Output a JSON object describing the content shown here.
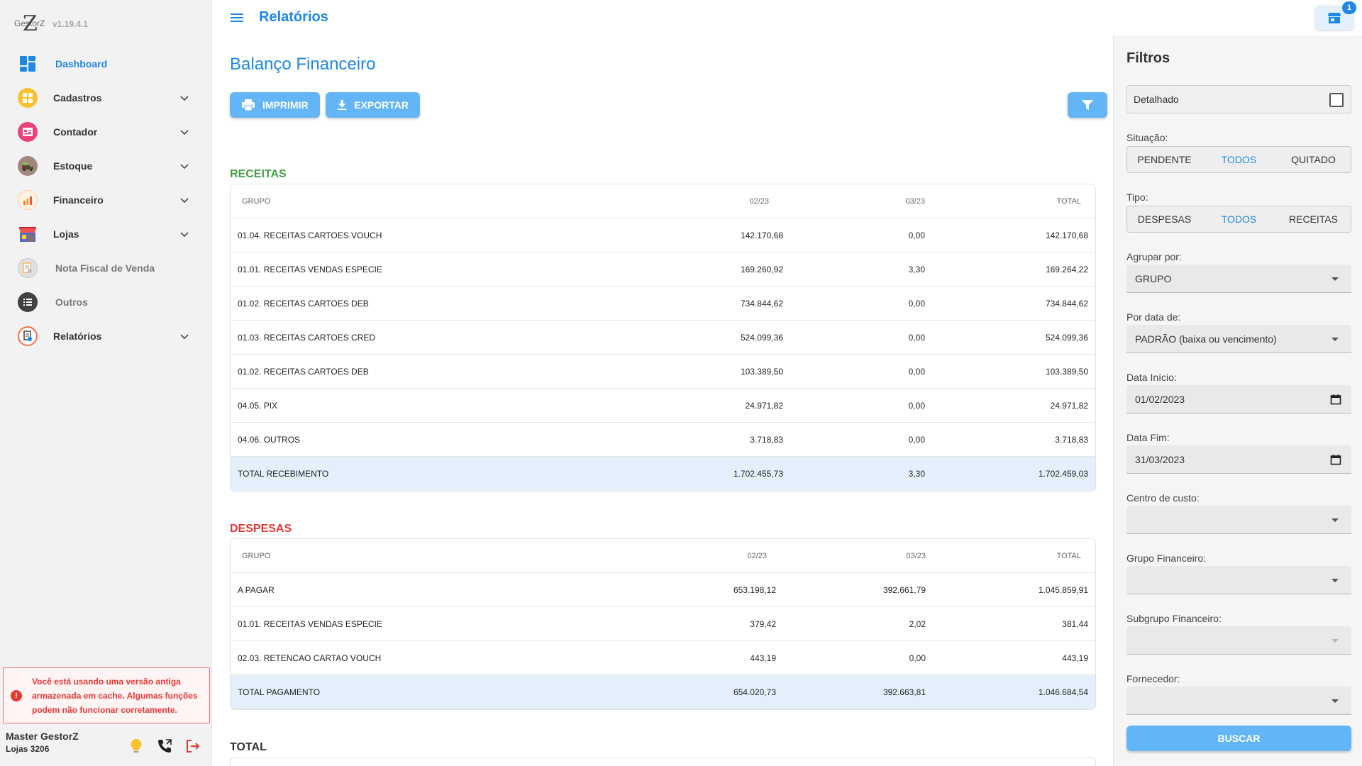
{
  "app": {
    "brand_name": "GestorZ",
    "version": "v1.19.4.1"
  },
  "sidebar": {
    "items": [
      {
        "label": "Dashboard",
        "icon": "dashboard-icon",
        "color": "#1e88e5"
      },
      {
        "label": "Cadastros",
        "icon": "cadastros-icon",
        "color": "#fbc02d"
      },
      {
        "label": "Contador",
        "icon": "contador-icon",
        "color": "#ec407a"
      },
      {
        "label": "Estoque",
        "icon": "estoque-icon",
        "color": "#8d6e63"
      },
      {
        "label": "Financeiro",
        "icon": "financeiro-icon",
        "color": "#ff7043"
      },
      {
        "label": "Lojas",
        "icon": "lojas-icon",
        "color": "#5c6bc0"
      },
      {
        "label": "Nota Fiscal de Venda",
        "icon": "nota-fiscal-icon",
        "color": "#bdbdbd"
      },
      {
        "label": "Outros",
        "icon": "outros-icon",
        "color": "#424242"
      },
      {
        "label": "Relatórios",
        "icon": "relatorios-icon",
        "color": "#ff7043"
      }
    ],
    "cache_alert": "Você está usando uma versão antiga armazenada em cache. Algumas funções podem não funcionar corretamente.",
    "user": {
      "name": "Master GestorZ",
      "store": "Lojas 3206"
    }
  },
  "header": {
    "title": "Relatórios",
    "store_badge": "1"
  },
  "main": {
    "title": "Balanço Financeiro",
    "print_label": "IMPRIMIR",
    "export_label": "EXPORTAR",
    "receitas": {
      "title": "RECEITAS",
      "headers": [
        "GRUPO",
        "02/23",
        "03/23",
        "TOTAL"
      ],
      "rows": [
        [
          "01.04. RECEITAS CARTOES VOUCH",
          "142.170,68",
          "0,00",
          "142.170,68"
        ],
        [
          "01.01. RECEITAS VENDAS ESPECIE",
          "169.260,92",
          "3,30",
          "169.264,22"
        ],
        [
          "01.02. RECEITAS CARTOES DEB",
          "734.844,62",
          "0,00",
          "734.844,62"
        ],
        [
          "01.03. RECEITAS CARTOES CRED",
          "524.099,36",
          "0,00",
          "524.099,36"
        ],
        [
          "01.02. RECEITAS CARTOES DEB",
          "103.389,50",
          "0,00",
          "103.389,50"
        ],
        [
          "04.05. PIX",
          "24.971,82",
          "0,00",
          "24.971,82"
        ],
        [
          "04.06. OUTROS",
          "3.718,83",
          "0,00",
          "3.718,83"
        ]
      ],
      "total": [
        "TOTAL RECEBIMENTO",
        "1.702.455,73",
        "3,30",
        "1.702.459,03"
      ]
    },
    "despesas": {
      "title": "DESPESAS",
      "headers": [
        "GRUPO",
        "02/23",
        "03/23",
        "TOTAL"
      ],
      "rows": [
        [
          "A PAGAR",
          "653.198,12",
          "392.661,79",
          "1.045.859,91"
        ],
        [
          "01.01. RECEITAS VENDAS ESPECIE",
          "379,42",
          "2,02",
          "381,44"
        ],
        [
          "02.03. RETENCAO CARTAO VOUCH",
          "443,19",
          "0,00",
          "443,19"
        ]
      ],
      "total": [
        "TOTAL PAGAMENTO",
        "654.020,73",
        "392.663,81",
        "1.046.684,54"
      ]
    },
    "total_section": {
      "title": "TOTAL"
    }
  },
  "filters": {
    "title": "Filtros",
    "detalhado_label": "Detalhado",
    "situacao": {
      "label": "Situação:",
      "options": [
        "PENDENTE",
        "TODOS",
        "QUITADO"
      ],
      "selected": "TODOS"
    },
    "tipo": {
      "label": "Tipo:",
      "options": [
        "DESPESAS",
        "TODOS",
        "RECEITAS"
      ],
      "selected": "TODOS"
    },
    "agrupar": {
      "label": "Agrupar por:",
      "value": "GRUPO"
    },
    "por_data": {
      "label": "Por data de:",
      "value": "PADRÃO (baixa ou vencimento)"
    },
    "data_inicio": {
      "label": "Data Início:",
      "value": "01/02/2023"
    },
    "data_fim": {
      "label": "Data Fim:",
      "value": "31/03/2023"
    },
    "centro_custo": {
      "label": "Centro de custo:",
      "value": ""
    },
    "grupo_financeiro": {
      "label": "Grupo Financeiro:",
      "value": ""
    },
    "subgrupo_financeiro": {
      "label": "Subgrupo Financeiro:",
      "value": ""
    },
    "fornecedor": {
      "label": "Fornecedor:",
      "value": ""
    },
    "search_label": "BUSCAR"
  },
  "colors": {
    "accent": "#1e88e5",
    "button": "#64b5f6",
    "receitas": "#43a047",
    "despesas": "#e53935",
    "total_row": "#e3f0fc"
  }
}
